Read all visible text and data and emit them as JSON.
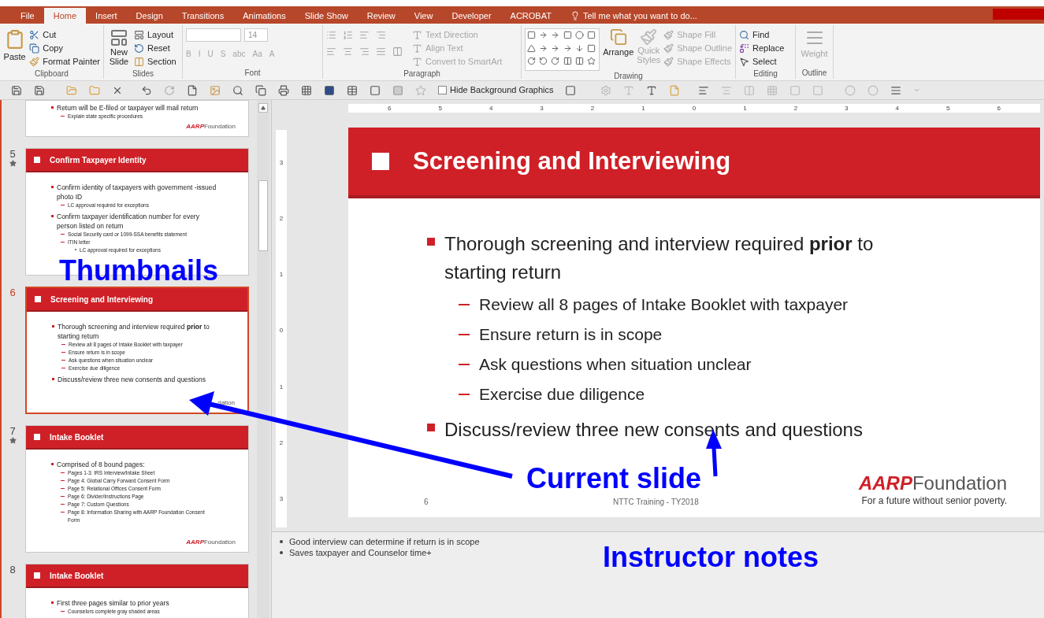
{
  "tabs": [
    {
      "label": "File",
      "selected": false
    },
    {
      "label": "Home",
      "selected": true
    },
    {
      "label": "Insert",
      "selected": false
    },
    {
      "label": "Design",
      "selected": false
    },
    {
      "label": "Transitions",
      "selected": false
    },
    {
      "label": "Animations",
      "selected": false
    },
    {
      "label": "Slide Show",
      "selected": false
    },
    {
      "label": "Review",
      "selected": false
    },
    {
      "label": "View",
      "selected": false
    },
    {
      "label": "Developer",
      "selected": false
    },
    {
      "label": "ACROBAT",
      "selected": false
    }
  ],
  "tell_me": "Tell me what you want to do...",
  "ribbon": {
    "clipboard": {
      "label": "Clipboard",
      "paste": "Paste",
      "commands": [
        {
          "label": "Cut",
          "disabled": false
        },
        {
          "label": "Copy",
          "disabled": false
        },
        {
          "label": "Format Painter",
          "disabled": false
        }
      ]
    },
    "slides": {
      "label": "Slides",
      "new_slide": "New Slide",
      "commands": [
        {
          "label": "Layout",
          "disabled": false
        },
        {
          "label": "Reset",
          "disabled": false
        },
        {
          "label": "Section",
          "disabled": false
        }
      ]
    },
    "font": {
      "label": "Font",
      "size": "14",
      "disabled": true,
      "buttons": [
        "B",
        "I",
        "U",
        "S",
        "abc",
        "Aa",
        "A"
      ]
    },
    "paragraph": {
      "label": "Paragraph",
      "commands": [
        {
          "label": "Text Direction",
          "disabled": true
        },
        {
          "label": "Align Text",
          "disabled": true
        },
        {
          "label": "Convert to SmartArt",
          "disabled": true
        }
      ]
    },
    "drawing": {
      "label": "Drawing",
      "arrange": "Arrange",
      "quick_styles": "Quick Styles",
      "commands": [
        {
          "label": "Shape Fill",
          "disabled": true
        },
        {
          "label": "Shape Outline",
          "disabled": true
        },
        {
          "label": "Shape Effects",
          "disabled": true
        }
      ]
    },
    "editing": {
      "label": "Editing",
      "commands": [
        {
          "label": "Find",
          "disabled": false
        },
        {
          "label": "Replace",
          "disabled": false
        },
        {
          "label": "Select",
          "disabled": false
        }
      ]
    },
    "outline": {
      "label": "Outline",
      "weight": "Weight",
      "disabled": true
    }
  },
  "toolbar": {
    "hide_background": {
      "label": "Hide Background Graphics",
      "checked": false
    }
  },
  "thumbnails": [
    {
      "kind": "partial",
      "starred": false,
      "selected": false,
      "bullets": [
        {
          "text": "Return will be E-filed or taxpayer will mail return",
          "children": [
            {
              "text": "Explain state specific procedures"
            }
          ]
        }
      ],
      "logo": "AARP",
      "logo_name": "Foundation"
    },
    {
      "kind": "full",
      "number": "5",
      "starred": true,
      "selected": false,
      "title": "Confirm Taxpayer Identity",
      "bullets": [
        {
          "text": "Confirm identity of taxpayers with government -issued photo ID",
          "children": [
            {
              "text": "LC approval required for exceptions"
            }
          ]
        },
        {
          "text": "Confirm taxpayer identification number for every person listed on return",
          "children": [
            {
              "text": "Social Security card or 1099-SSA benefits statement"
            },
            {
              "text": "ITIN letter",
              "children": [
                {
                  "text": "LC approval required for exceptions"
                }
              ]
            }
          ]
        }
      ]
    },
    {
      "kind": "full",
      "number": "6",
      "starred": false,
      "selected": true,
      "title": "Screening and Interviewing",
      "bullets": [
        {
          "text": "Thorough screening and interview required **prior** to starting return",
          "children": [
            {
              "text": "Review all 8 pages of Intake Booklet with taxpayer"
            },
            {
              "text": "Ensure return is in scope"
            },
            {
              "text": "Ask questions when situation unclear"
            },
            {
              "text": "Exercise due diligence"
            }
          ]
        },
        {
          "text": "Discuss/review three new consents and questions"
        }
      ],
      "logo_name": "dation"
    },
    {
      "kind": "full",
      "number": "7",
      "starred": true,
      "selected": false,
      "title": "Intake Booklet",
      "bullets": [
        {
          "text": "Comprised of 8 bound pages:",
          "children": [
            {
              "text": "Pages 1-3:  IRS Interview/Intake Sheet"
            },
            {
              "text": "Page 4:  Global Carry Forward Consent Form"
            },
            {
              "text": "Page 5:  Relational Offices Consent Form"
            },
            {
              "text": "Page 6:  Divider/Instructions Page"
            },
            {
              "text": "Page 7:  Custom Questions"
            },
            {
              "text": "Page 8:  Information Sharing with AARP Foundation Consent Form"
            }
          ]
        }
      ],
      "logo": "AARP",
      "logo_name": "Foundation"
    },
    {
      "kind": "full",
      "number": "8",
      "starred": false,
      "selected": false,
      "title": "Intake Booklet",
      "bullets": [
        {
          "text": "First three pages similar to prior years",
          "children": [
            {
              "text": "Counselors complete gray shaded areas"
            }
          ]
        }
      ]
    }
  ],
  "ruler_h": [
    "6",
    "5",
    "4",
    "3",
    "2",
    "1",
    "0",
    "1",
    "2",
    "3",
    "4",
    "5",
    "6"
  ],
  "ruler_v": [
    "3",
    "2",
    "1",
    "0",
    "1",
    "2",
    "3"
  ],
  "slide": {
    "title": "Screening and Interviewing",
    "bullets": [
      {
        "text": "Thorough screening and interview required **prior** to starting return",
        "children": [
          {
            "text": "Review all 8 pages of Intake Booklet with taxpayer"
          },
          {
            "text": "Ensure return is in scope"
          },
          {
            "text": "Ask questions when situation unclear"
          },
          {
            "text": "Exercise due diligence"
          }
        ]
      },
      {
        "text": "Discuss/review three new consents and questions"
      }
    ],
    "number": "6",
    "footer": "NTTC Training - TY2018",
    "logo": "AARP",
    "logo_name": "Foundation",
    "tagline": "For a future without senior poverty."
  },
  "notes": [
    "Good interview can determine if return is in scope",
    "Saves taxpayer and Counselor time+"
  ],
  "annotations": [
    {
      "text": "Thumbnails"
    },
    {
      "text": "Current slide"
    },
    {
      "text": "Instructor notes"
    }
  ]
}
